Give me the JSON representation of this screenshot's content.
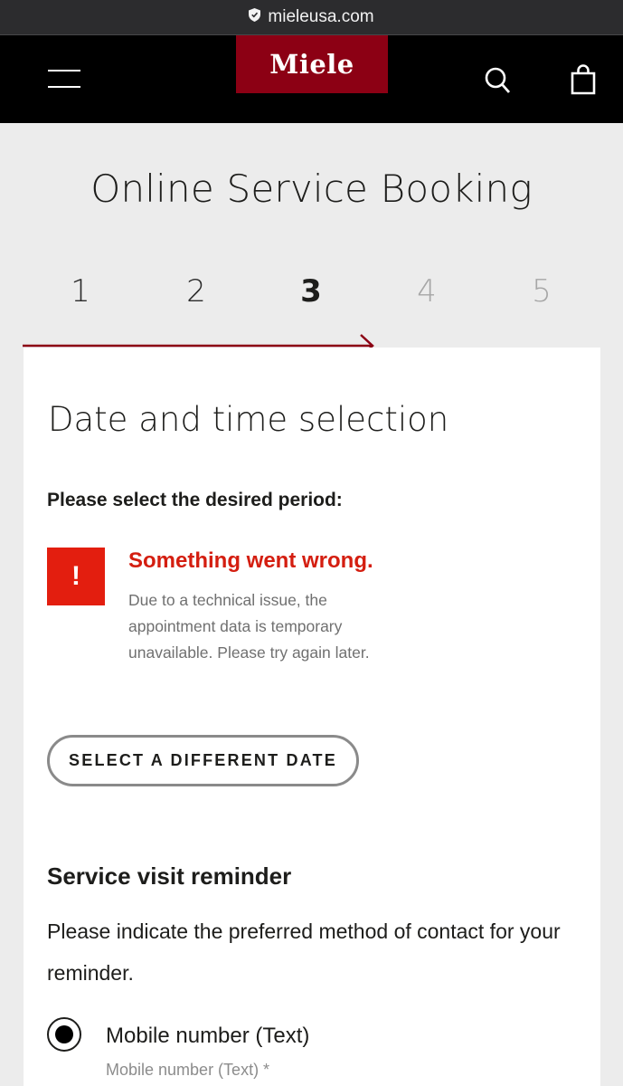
{
  "browser": {
    "url": "mieleusa.com"
  },
  "header": {
    "logo_text": "Miele",
    "brand_color": "#8c0014"
  },
  "page": {
    "title": "Online Service Booking"
  },
  "steps": [
    {
      "label": "1",
      "state": "done"
    },
    {
      "label": "2",
      "state": "done"
    },
    {
      "label": "3",
      "state": "current"
    },
    {
      "label": "4",
      "state": "future"
    },
    {
      "label": "5",
      "state": "future"
    }
  ],
  "section": {
    "title": "Date and time selection",
    "period_label": "Please select the desired period:"
  },
  "error": {
    "icon": "!",
    "title": "Something went wrong.",
    "description": "Due to a technical issue, the appointment data is temporary unavailable. Please try again later.",
    "color": "#e31e0f"
  },
  "buttons": {
    "different_date": "SELECT A DIFFERENT DATE"
  },
  "reminder": {
    "title": "Service visit reminder",
    "description": "Please indicate the preferred method of contact for your reminder.",
    "option_label": "Mobile number (Text)",
    "option_selected": true,
    "field_label": "Mobile number (Text) *"
  }
}
